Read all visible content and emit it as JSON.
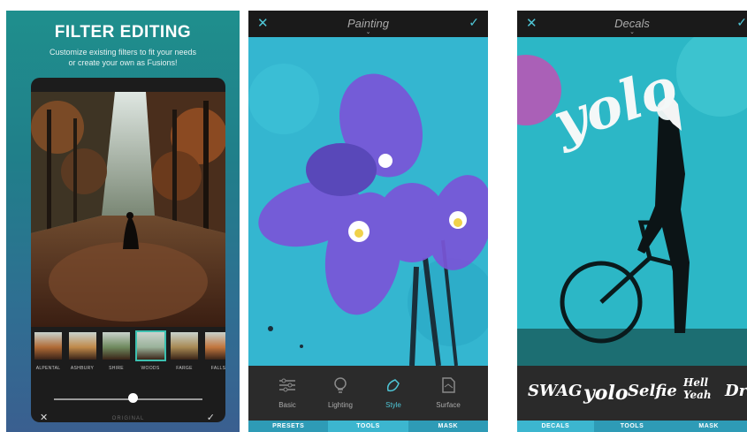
{
  "panel1": {
    "title": "FILTER EDITING",
    "subtitle_line1": "Customize existing filters to fit your needs",
    "subtitle_line2": "or create your own as Fusions!",
    "filters": [
      {
        "label": "ALPENTAL",
        "color": "#b06a36"
      },
      {
        "label": "ASHBURY",
        "color": "#c08a4a"
      },
      {
        "label": "SHIRE",
        "color": "#6f8a5e"
      },
      {
        "label": "WOODS",
        "color": "#9ab29a"
      },
      {
        "label": "FARGE",
        "color": "#a88a54"
      },
      {
        "label": "FALLS",
        "color": "#c2763e"
      }
    ],
    "slider_value": 0.53,
    "bottom_label": "ORIGINAL",
    "close_icon": "close-icon",
    "confirm_icon": "checkmark-icon"
  },
  "panel2": {
    "title": "Painting",
    "tools": [
      "Basic",
      "Lighting",
      "Style",
      "Surface"
    ],
    "active_tool": "Style",
    "tabs": [
      "PRESETS",
      "TOOLS",
      "MASK"
    ],
    "active_tab": "TOOLS",
    "accent": "#4fc6d6"
  },
  "panel3": {
    "title": "Decals",
    "image_text": "yolo",
    "decals": [
      "SWAG",
      "yolo",
      "Selfie",
      "Hell Yeah",
      "Dr..."
    ],
    "tabs": [
      "DECALS",
      "TOOLS",
      "MASK"
    ],
    "active_tab": "DECALS"
  }
}
